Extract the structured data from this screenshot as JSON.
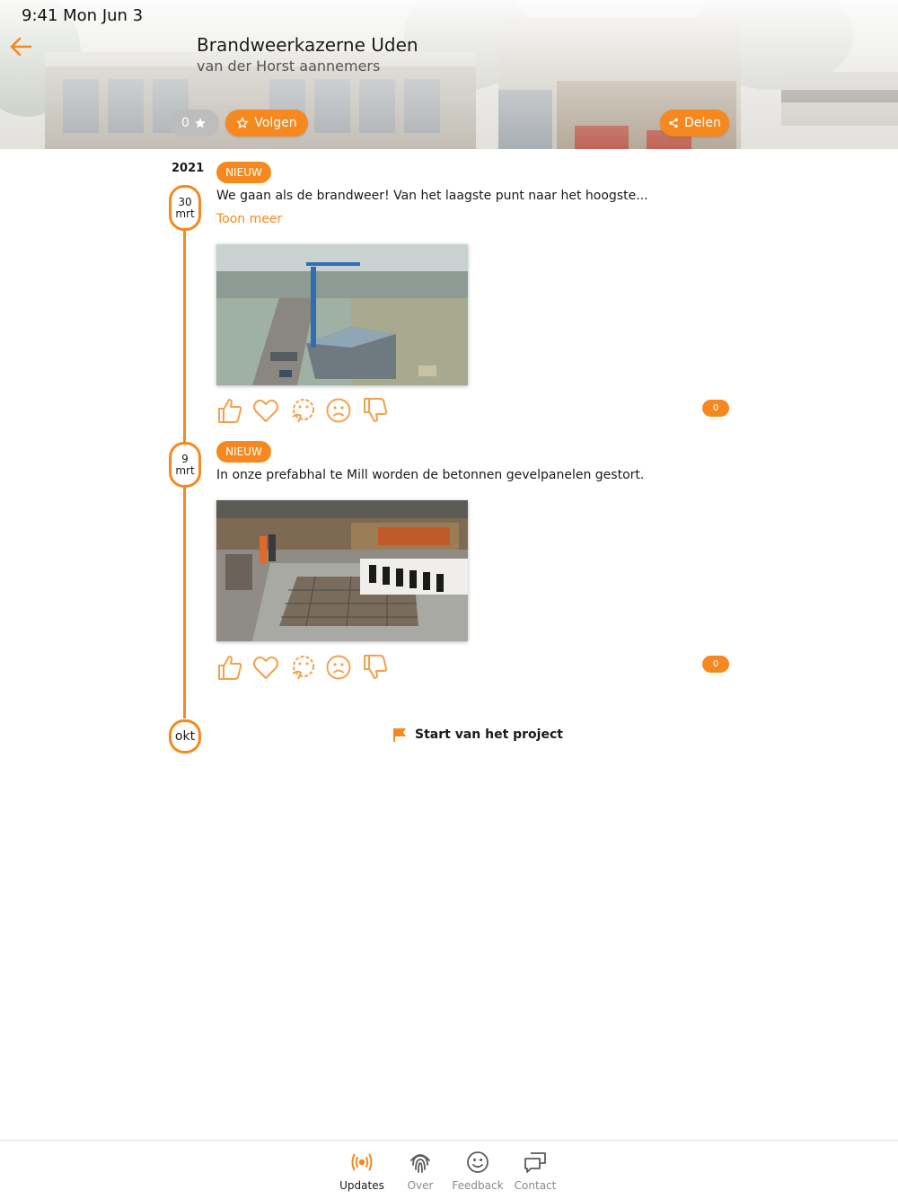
{
  "status_bar": {
    "time": "9:41  Mon Jun 3"
  },
  "header": {
    "title": "Brandweerkazerne Uden",
    "subtitle": "van der Horst aannemers",
    "rating_count": "0",
    "follow_label": "Volgen",
    "share_label": "Delen"
  },
  "timeline": {
    "year": "2021",
    "posts": [
      {
        "day": "30",
        "month": "mrt",
        "badge": "NIEUW",
        "text": "We gaan als de brandweer! Van het laagste punt naar het hoogste...",
        "more_label": "Toon meer",
        "photo": "aerial-construction-site-photo",
        "comment_count": "0"
      },
      {
        "day": "9",
        "month": "mrt",
        "badge": "NIEUW",
        "text": "In onze prefabhal te Mill worden de betonnen gevelpanelen gestort.",
        "photo": "prefab-factory-photo",
        "comment_count": "0"
      }
    ],
    "start": {
      "month": "okt",
      "label": "Start van het project"
    }
  },
  "reactions": [
    "thumbs-up-icon",
    "heart-icon",
    "thinking-face-icon",
    "sad-face-icon",
    "thumbs-down-icon"
  ],
  "tabbar": {
    "tabs": [
      {
        "label": "Updates",
        "icon": "broadcast-icon",
        "active": true
      },
      {
        "label": "Over",
        "icon": "fingerprint-icon",
        "active": false
      },
      {
        "label": "Feedback",
        "icon": "smiley-icon",
        "active": false
      },
      {
        "label": "Contact",
        "icon": "chat-bubbles-icon",
        "active": false
      }
    ]
  },
  "colors": {
    "accent": "#f5891f",
    "text": "#1a1a1a",
    "muted": "#8a8a8a",
    "rating_pill": "#bdbdbd"
  }
}
